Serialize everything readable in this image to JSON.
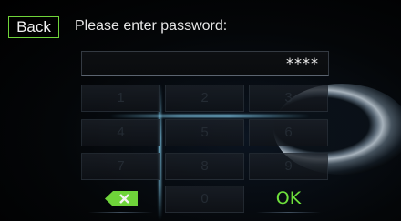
{
  "header": {
    "back_label": "Back",
    "title": "Please enter password:"
  },
  "password_field": {
    "value": "****"
  },
  "keypad": {
    "keys": [
      "1",
      "2",
      "3",
      "4",
      "5",
      "6",
      "7",
      "8",
      "9",
      "0"
    ],
    "ok_label": "OK",
    "delete_icon": "backspace-x-icon"
  },
  "colors": {
    "accent": "#6fd43a",
    "ok_text": "#6ee03c",
    "title_text": "#e6e6e6",
    "dim_key_text": "#242b33"
  }
}
